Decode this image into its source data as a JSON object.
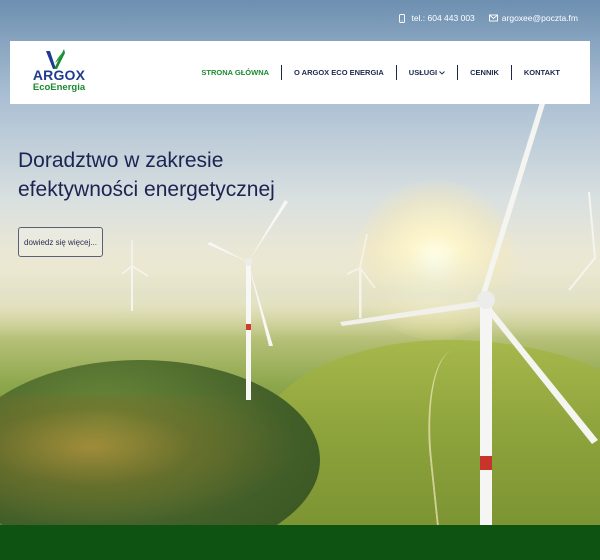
{
  "contact": {
    "phone": "tel.: 604 443 003",
    "email": "argoxee@poczta.fm",
    "phone_icon": "phone-icon",
    "email_icon": "envelope-icon"
  },
  "logo": {
    "brand": "ARGOX",
    "sub": "EcoEnergia",
    "mark_icon": "leaf-v-logo"
  },
  "nav": {
    "items": [
      {
        "label": "STRONA GŁÓWNA",
        "active": true
      },
      {
        "label": "O ARGOX ECO ENERGIA",
        "active": false
      },
      {
        "label": "USŁUGI",
        "active": false,
        "dropdown": true
      },
      {
        "label": "CENNIK",
        "active": false
      },
      {
        "label": "KONTAKT",
        "active": false
      }
    ]
  },
  "hero": {
    "title_line1": "Doradztwo w zakresie",
    "title_line2": "efektywności energetycznej",
    "button": "dowiedz się więcej..."
  },
  "colors": {
    "brand_blue": "#1f3b8f",
    "brand_green": "#1b8a2f",
    "nav_text": "#1d2850",
    "footer_green": "#0e5312"
  }
}
